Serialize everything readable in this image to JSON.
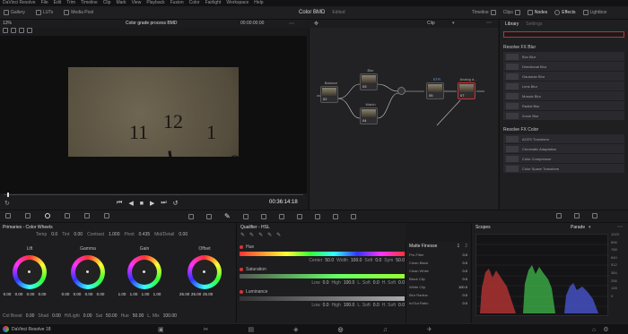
{
  "menu": [
    "DaVinci Resolve",
    "File",
    "Edit",
    "Trim",
    "Timeline",
    "Clip",
    "Mark",
    "View",
    "Playback",
    "Fusion",
    "Color",
    "Fairlight",
    "Workspace",
    "Help"
  ],
  "toolbar": {
    "left_items": [
      "Gallery",
      "LUTs",
      "Media Pool"
    ],
    "title": "Color BMD",
    "status": "Edited",
    "right_items": [
      "Timeline",
      "Clips",
      "Nodes",
      "Effects",
      "Lightbox"
    ]
  },
  "viewer": {
    "zoom": "13%",
    "clip_name": "Color grade process BMD",
    "timecode_top": "00:00:00:00",
    "timecode": "00:36:14:18"
  },
  "nodes": {
    "mode": "Clip",
    "items": [
      {
        "id": "02",
        "label": "Balance"
      },
      {
        "id": "03",
        "label": "Blur"
      },
      {
        "id": "04",
        "label": "Watch"
      },
      {
        "id": "05",
        "label": "ETR"
      },
      {
        "id": "07",
        "label": "Analog d..."
      }
    ]
  },
  "library": {
    "tab_active": "Library",
    "tab_inactive": "Settings",
    "sections": [
      {
        "title": "Resolve FX Blur",
        "items": [
          "Box Blur",
          "Directional Blur",
          "Gaussian Blur",
          "Lens Blur",
          "Mosaic Blur",
          "Radial Blur",
          "Zoom Blur"
        ]
      },
      {
        "title": "Resolve FX Color",
        "items": [
          "ACES Transform",
          "Chromatic Adaptation",
          "Color Compressor",
          "Color Space Transform"
        ]
      }
    ]
  },
  "wheels": {
    "title": "Primaries - Color Wheels",
    "top_params": [
      {
        "label": "Temp",
        "value": "0.0"
      },
      {
        "label": "Tint",
        "value": "0.00"
      },
      {
        "label": "Contrast",
        "value": "1.000"
      },
      {
        "label": "Pivot",
        "value": "0.435"
      },
      {
        "label": "Mid/Detail",
        "value": "0.00"
      }
    ],
    "items": [
      {
        "name": "Lift",
        "values": [
          "0.00",
          "0.00",
          "0.00",
          "0.00"
        ]
      },
      {
        "name": "Gamma",
        "values": [
          "0.00",
          "0.00",
          "0.00",
          "0.00"
        ]
      },
      {
        "name": "Gain",
        "values": [
          "1.00",
          "1.00",
          "1.00",
          "1.00"
        ]
      },
      {
        "name": "Offset",
        "values": [
          "25.00",
          "25.00",
          "25.00"
        ]
      }
    ],
    "bottom_params": [
      {
        "label": "Col Boost",
        "value": "0.00"
      },
      {
        "label": "Shad",
        "value": "0.00"
      },
      {
        "label": "Hi/Light",
        "value": "0.00"
      },
      {
        "label": "Sat",
        "value": "50.00"
      },
      {
        "label": "Hue",
        "value": "50.00"
      },
      {
        "label": "L. Mix",
        "value": "100.00"
      }
    ]
  },
  "hsl": {
    "title": "Qualifier - HSL",
    "sections": [
      {
        "name": "Hue",
        "params": [
          {
            "label": "Center",
            "value": "50.0"
          },
          {
            "label": "Width",
            "value": "100.0"
          },
          {
            "label": "Soft",
            "value": "0.0"
          },
          {
            "label": "Sym",
            "value": "50.0"
          }
        ]
      },
      {
        "name": "Saturation",
        "params": [
          {
            "label": "Low",
            "value": "0.0"
          },
          {
            "label": "High",
            "value": "100.0"
          },
          {
            "label": "L. Soft",
            "value": "0.0"
          },
          {
            "label": "H. Soft",
            "value": "0.0"
          }
        ]
      },
      {
        "name": "Luminance",
        "params": [
          {
            "label": "Low",
            "value": "0.0"
          },
          {
            "label": "High",
            "value": "100.0"
          },
          {
            "label": "L. Soft",
            "value": "0.0"
          },
          {
            "label": "H. Soft",
            "value": "0.0"
          }
        ]
      }
    ]
  },
  "matte": {
    "title": "Matte Finesse",
    "page": "1",
    "page2": "2",
    "rows": [
      {
        "label": "Pre-Filter",
        "value": "0.0"
      },
      {
        "label": "Clean Black",
        "value": "0.0"
      },
      {
        "label": "Clean White",
        "value": "0.0"
      },
      {
        "label": "Black Clip",
        "value": "0.0"
      },
      {
        "label": "White Clip",
        "value": "100.0"
      },
      {
        "label": "Blur Radius",
        "value": "0.0"
      },
      {
        "label": "In/Out Ratio",
        "value": "0.0"
      }
    ]
  },
  "scopes": {
    "title": "Scopes",
    "mode": "Parade",
    "scale": [
      "1023",
      "896",
      "768",
      "640",
      "512",
      "384",
      "256",
      "128",
      "0"
    ]
  },
  "status": {
    "app": "DaVinci Resolve 18"
  }
}
